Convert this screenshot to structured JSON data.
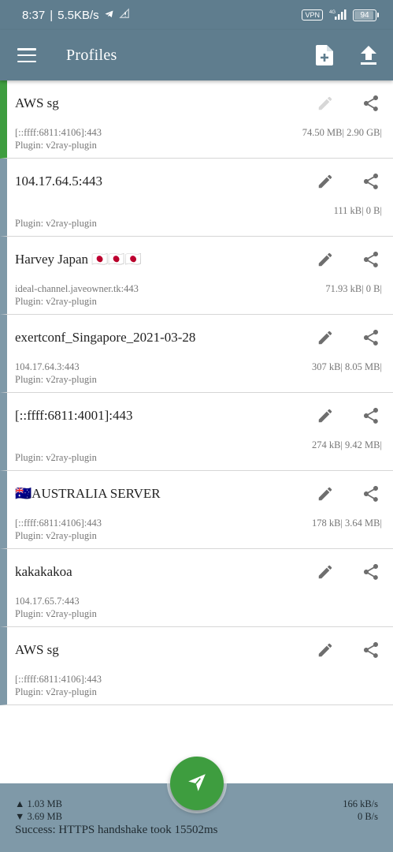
{
  "status_bar": {
    "time": "8:37",
    "net_speed": "5.5KB/s",
    "vpn_label": "VPN",
    "battery": "94"
  },
  "app_bar": {
    "title": "Profiles",
    "icons": [
      "menu-icon",
      "add-file-icon",
      "upload-icon"
    ]
  },
  "colors": {
    "primary": "#5f7d8e",
    "accent_green": "#3e9d3f",
    "card_stripe": "#7f99a8"
  },
  "profiles": [
    {
      "name": "AWS sg",
      "host": "[::ffff:6811:4106]:443",
      "plugin": "Plugin: v2ray-plugin",
      "traffic": "74.50 MB| 2.90 GB|",
      "selected": true
    },
    {
      "name": "104.17.64.5:443",
      "host": "",
      "plugin": "Plugin: v2ray-plugin",
      "traffic": "111 kB| 0 B|"
    },
    {
      "name": "Harvey Japan 🇯🇵🇯🇵🇯🇵",
      "host": "ideal-channel.javeowner.tk:443",
      "plugin": "Plugin: v2ray-plugin",
      "traffic": "71.93 kB| 0 B|"
    },
    {
      "name": "exertconf_Singapore_2021-03-28",
      "host": "104.17.64.3:443",
      "plugin": "Plugin: v2ray-plugin",
      "traffic": "307 kB| 8.05 MB|"
    },
    {
      "name": "[::ffff:6811:4001]:443",
      "host": "",
      "plugin": "Plugin: v2ray-plugin",
      "traffic": "274 kB| 9.42 MB|"
    },
    {
      "name": "🇦🇺AUSTRALIA SERVER",
      "host": "[::ffff:6811:4106]:443",
      "plugin": "Plugin: v2ray-plugin",
      "traffic": "178 kB| 3.64 MB|"
    },
    {
      "name": "kakakakoa",
      "host": "104.17.65.7:443",
      "plugin": "Plugin: v2ray-plugin",
      "traffic": ""
    },
    {
      "name": "AWS sg",
      "host": "[::ffff:6811:4106]:443",
      "plugin": "Plugin: v2ray-plugin",
      "traffic": ""
    }
  ],
  "footer": {
    "tx_total": "▲ 1.03 MB",
    "rx_total": "▼ 3.69 MB",
    "tx_rate": "166 kB/s",
    "rx_rate": "0 B/s",
    "status": "Success: HTTPS handshake took 15502ms"
  }
}
